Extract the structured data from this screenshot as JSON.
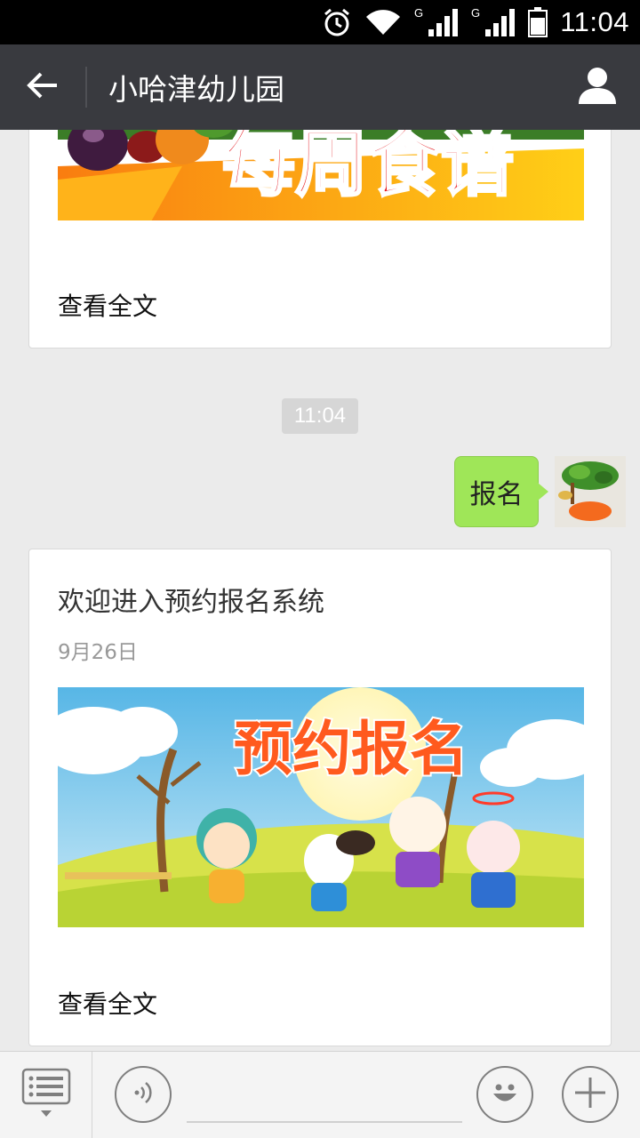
{
  "status_bar": {
    "time": "11:04",
    "icons": [
      "alarm-icon",
      "wifi-icon",
      "signal-g-icon",
      "signal-g-icon",
      "battery-icon"
    ],
    "network_label": "G"
  },
  "header": {
    "title": "小哈津幼儿园",
    "back_icon": "arrow-left-icon",
    "profile_icon": "person-icon"
  },
  "messages": {
    "article_1": {
      "banner_text": "每周食谱",
      "read_more": "查看全文"
    },
    "timestamp": "11:04",
    "outgoing": {
      "text": "报名"
    },
    "article_2": {
      "title": "欢迎进入预约报名系统",
      "date": "9月26日",
      "banner_text": "预约报名",
      "read_more": "查看全文"
    }
  },
  "input_bar": {
    "menu_icon": "menu-list-icon",
    "voice_icon": "voice-icon",
    "emoji_icon": "emoji-icon",
    "plus_icon": "plus-icon",
    "input_value": ""
  },
  "colors": {
    "title_bar": "#393a3f",
    "bubble_green": "#9fe658",
    "background": "#ebebeb"
  }
}
